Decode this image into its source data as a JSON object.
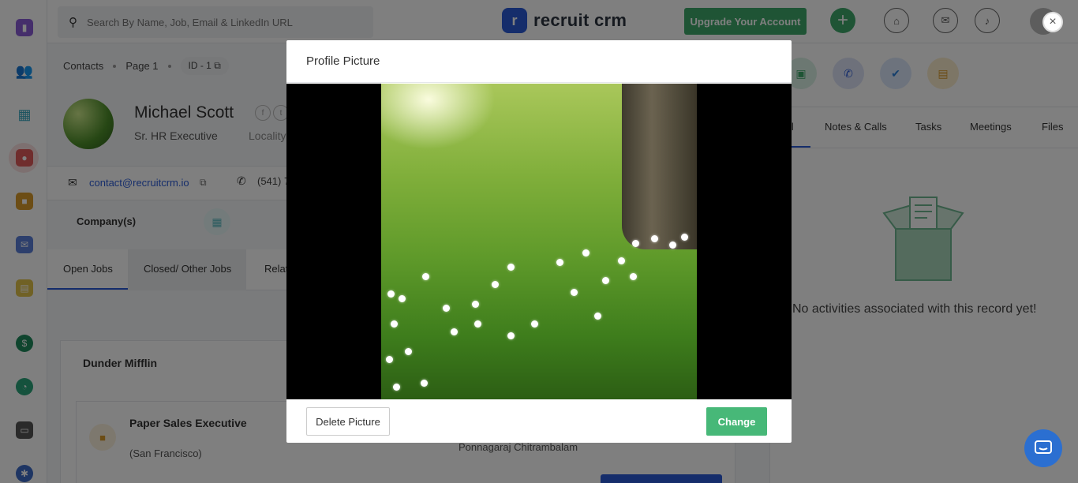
{
  "search": {
    "placeholder": "Search By Name, Job, Email & LinkedIn URL"
  },
  "brand": {
    "name": "recruit crm",
    "mark": "r"
  },
  "topbar": {
    "upgrade_label": "Upgrade Your Account",
    "add_label": "+"
  },
  "breadcrumb": {
    "section": "Contacts",
    "page": "Page 1",
    "id": "ID - 1"
  },
  "profile": {
    "name": "Michael Scott",
    "title": "Sr. HR Executive",
    "locality": "Locality",
    "email": "contact@recruitcrm.io",
    "phone": "(541) 7"
  },
  "company_section": {
    "label": "Company(s)"
  },
  "left_tabs": [
    "Open Jobs",
    "Closed/ Other Jobs",
    "Relat"
  ],
  "job_card": {
    "company": "Dunder Mifflin",
    "job_title": "Paper Sales Executive",
    "location": "(San Francisco)",
    "recruiter": "Ponnagaraj Chitrambalam"
  },
  "right_tabs": [
    "ll",
    "Notes & Calls",
    "Tasks",
    "Meetings",
    "Files"
  ],
  "activity": {
    "empty_text": "No activities associated with this record yet!"
  },
  "modal": {
    "title": "Profile Picture",
    "delete_label": "Delete Picture",
    "change_label": "Change"
  },
  "icons": {
    "close": "×",
    "sidebar": [
      "reports-icon",
      "users-icon",
      "building-icon",
      "contacts-icon",
      "jobs-icon",
      "mail-icon",
      "calendar-icon",
      "billing-icon",
      "pie-chart-icon",
      "card-icon",
      "settings-icon"
    ]
  },
  "colors": {
    "accent_green": "#3fa86a",
    "brand_blue": "#2a5bd7",
    "change_button": "#47b878"
  }
}
